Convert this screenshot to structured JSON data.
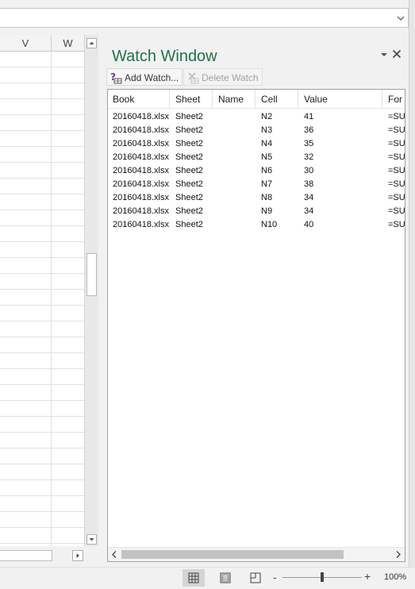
{
  "grid": {
    "columns": [
      "V",
      "W"
    ],
    "row_count": 33
  },
  "watch_window": {
    "title": "Watch Window",
    "add_watch_label": "Add Watch...",
    "delete_watch_label": "Delete Watch",
    "headers": [
      "Book",
      "Sheet",
      "Name",
      "Cell",
      "Value",
      "Formula"
    ],
    "visible_headers": {
      "book": "Book",
      "sheet": "Sheet",
      "name": "Name",
      "cell": "Cell",
      "value": "Value",
      "formula": "For"
    },
    "rows": [
      {
        "book": "20160418.xlsx",
        "sheet": "Sheet2",
        "name": "",
        "cell": "N2",
        "value": "41",
        "formula": "=SU"
      },
      {
        "book": "20160418.xlsx",
        "sheet": "Sheet2",
        "name": "",
        "cell": "N3",
        "value": "36",
        "formula": "=SU"
      },
      {
        "book": "20160418.xlsx",
        "sheet": "Sheet2",
        "name": "",
        "cell": "N4",
        "value": "35",
        "formula": "=SU"
      },
      {
        "book": "20160418.xlsx",
        "sheet": "Sheet2",
        "name": "",
        "cell": "N5",
        "value": "32",
        "formula": "=SU"
      },
      {
        "book": "20160418.xlsx",
        "sheet": "Sheet2",
        "name": "",
        "cell": "N6",
        "value": "30",
        "formula": "=SU"
      },
      {
        "book": "20160418.xlsx",
        "sheet": "Sheet2",
        "name": "",
        "cell": "N7",
        "value": "38",
        "formula": "=SU"
      },
      {
        "book": "20160418.xlsx",
        "sheet": "Sheet2",
        "name": "",
        "cell": "N8",
        "value": "34",
        "formula": "=SU"
      },
      {
        "book": "20160418.xlsx",
        "sheet": "Sheet2",
        "name": "",
        "cell": "N9",
        "value": "34",
        "formula": "=SU"
      },
      {
        "book": "20160418.xlsx",
        "sheet": "Sheet2",
        "name": "",
        "cell": "N10",
        "value": "40",
        "formula": "=SU"
      }
    ]
  },
  "status_bar": {
    "zoom_level": "100%",
    "zoom_minus": "-",
    "zoom_plus": "+"
  },
  "icons": {
    "add_watch": "add-watch-icon",
    "delete_watch": "delete-watch-icon",
    "close": "close-icon",
    "menu": "chevron-down-icon"
  },
  "colors": {
    "title": "#217346",
    "disabled_text": "#a2a2a2"
  }
}
